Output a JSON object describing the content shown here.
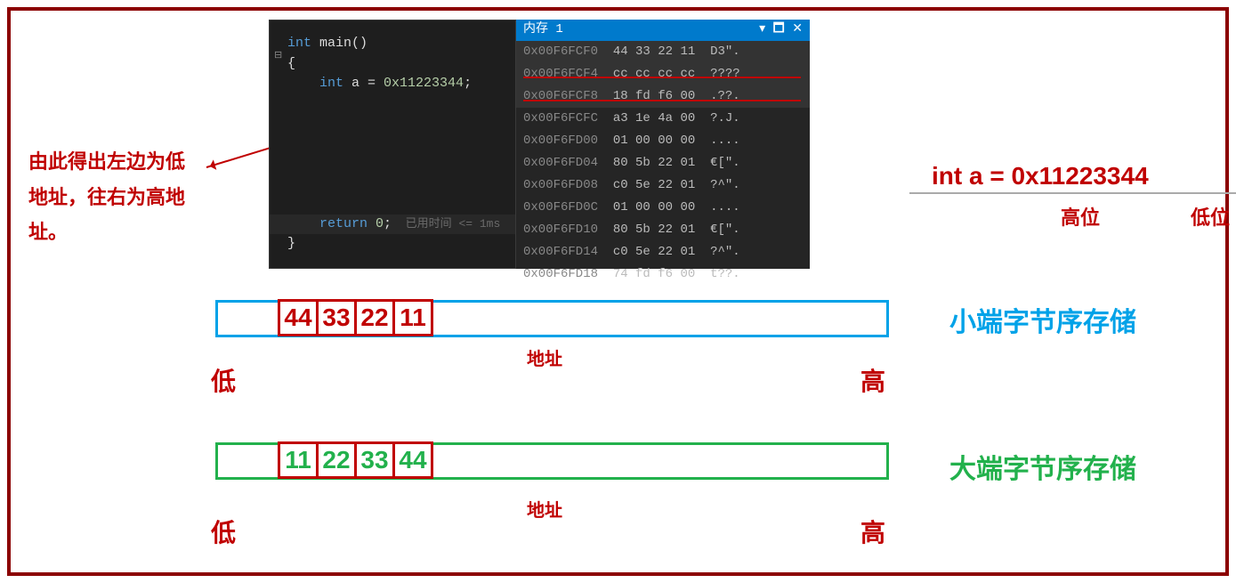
{
  "left_note_line1": "由此得出左边为低",
  "left_note_line2": "地址，往右为高地",
  "left_note_line3": "址。",
  "code": {
    "sig": "int main()",
    "kw_int": "int",
    "fn_main": " main()",
    "open": "{",
    "decl_kw": "int",
    "decl_rest": " a = ",
    "decl_val": "0x11223344",
    "semi": ";",
    "return_kw": "return",
    "return_val": " 0",
    "return_semi": ";",
    "elapsed": "  已用时间 <= 1ms",
    "close": "}"
  },
  "memory": {
    "title": "内存 1",
    "rows": [
      {
        "addr": "0x00F6FCF0",
        "bytes": "44 33 22 11",
        "ascii": "D3\"."
      },
      {
        "addr": "0x00F6FCF4",
        "bytes": "cc cc cc cc",
        "ascii": "????"
      },
      {
        "addr": "0x00F6FCF8",
        "bytes": "18 fd f6 00",
        "ascii": ".??."
      },
      {
        "addr": "0x00F6FCFC",
        "bytes": "a3 1e 4a 00",
        "ascii": "?.J."
      },
      {
        "addr": "0x00F6FD00",
        "bytes": "01 00 00 00",
        "ascii": "...."
      },
      {
        "addr": "0x00F6FD04",
        "bytes": "80 5b 22 01",
        "ascii": "€[\"."
      },
      {
        "addr": "0x00F6FD08",
        "bytes": "c0 5e 22 01",
        "ascii": "?^\"."
      },
      {
        "addr": "0x00F6FD0C",
        "bytes": "01 00 00 00",
        "ascii": "...."
      },
      {
        "addr": "0x00F6FD10",
        "bytes": "80 5b 22 01",
        "ascii": "€[\"."
      },
      {
        "addr": "0x00F6FD14",
        "bytes": "c0 5e 22 01",
        "ascii": "?^\"."
      },
      {
        "addr": "0x00F6FD18",
        "bytes": "74 fd f6 00",
        "ascii": "t??."
      }
    ]
  },
  "decl_text": "int a = 0x11223344",
  "decl_high": "高位",
  "decl_low": "低位",
  "little_title": "小端字节序存储",
  "big_title": "大端字节序存储",
  "little_bytes": [
    "44",
    "33",
    "22",
    "11"
  ],
  "big_bytes": [
    "11",
    "22",
    "33",
    "44"
  ],
  "addr_label": "地址",
  "low_label": "低",
  "high_label": "高"
}
